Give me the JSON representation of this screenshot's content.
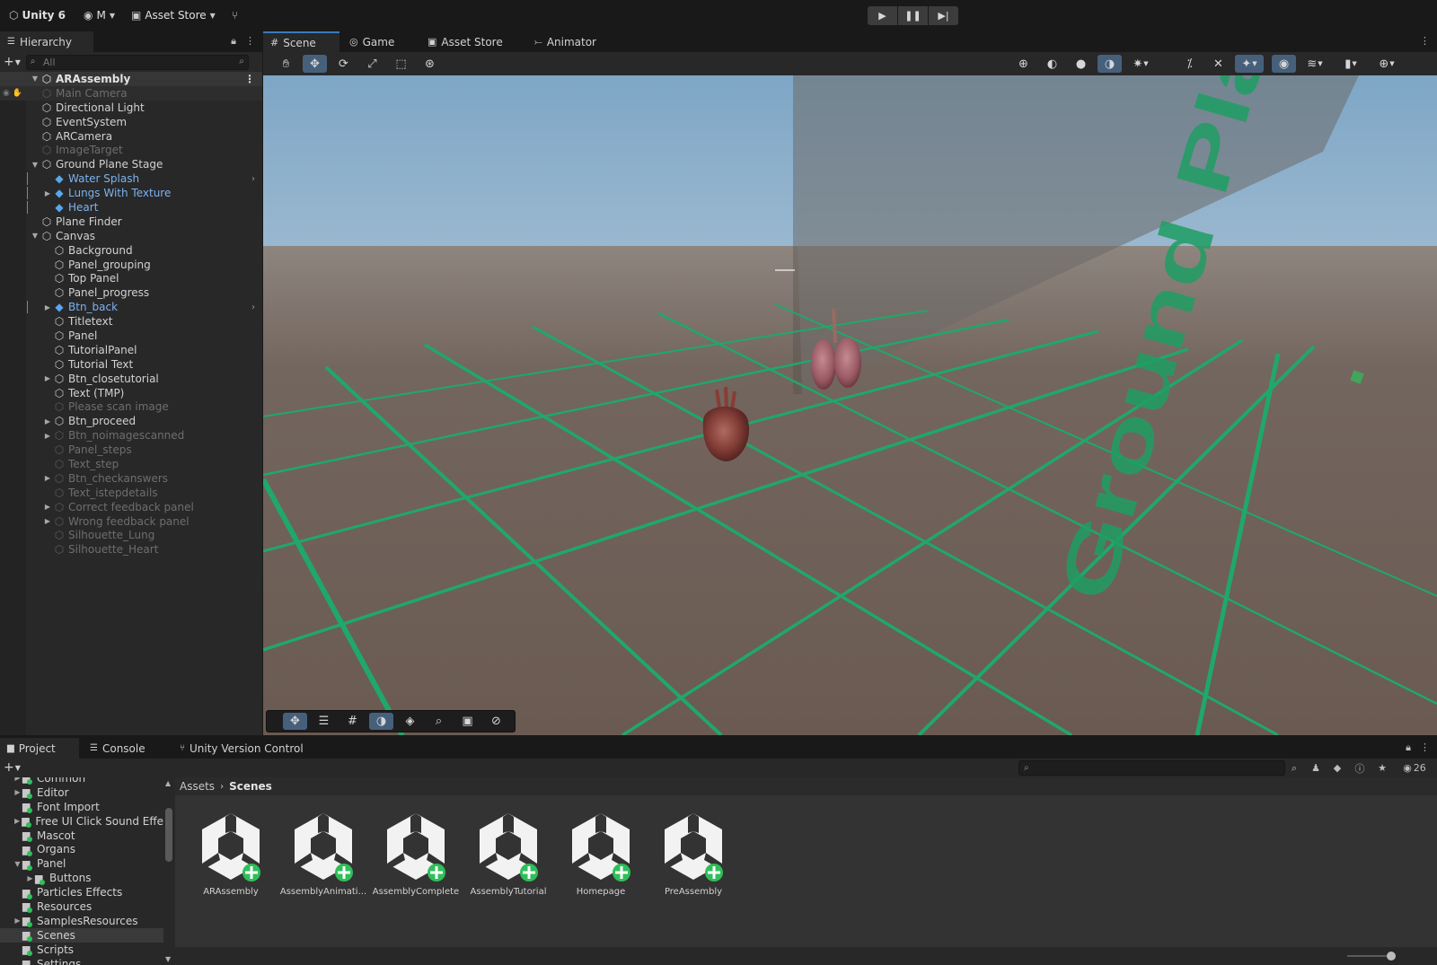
{
  "toolbar": {
    "app_title": "Unity 6",
    "account_label": "M",
    "asset_store_label": "Asset Store"
  },
  "hierarchy": {
    "tab_label": "Hierarchy",
    "search_placeholder": "All",
    "root": "ARAssembly",
    "items": [
      {
        "label": "Main Camera",
        "depth": 1,
        "state": "dim",
        "arrow": false
      },
      {
        "label": "Directional Light",
        "depth": 1,
        "state": "normal",
        "arrow": false
      },
      {
        "label": "EventSystem",
        "depth": 1,
        "state": "normal",
        "arrow": false
      },
      {
        "label": "ARCamera",
        "depth": 1,
        "state": "normal",
        "arrow": false
      },
      {
        "label": "ImageTarget",
        "depth": 1,
        "state": "dim",
        "arrow": false
      },
      {
        "label": "Ground Plane Stage",
        "depth": 1,
        "state": "normal",
        "arrow": "open"
      },
      {
        "label": "Water Splash",
        "depth": 2,
        "state": "prefab",
        "arrow": false
      },
      {
        "label": "Lungs With Texture",
        "depth": 2,
        "state": "prefab",
        "arrow": "closed"
      },
      {
        "label": "Heart",
        "depth": 2,
        "state": "prefab",
        "arrow": false
      },
      {
        "label": "Plane Finder",
        "depth": 1,
        "state": "normal",
        "arrow": false
      },
      {
        "label": "Canvas",
        "depth": 1,
        "state": "normal",
        "arrow": "open"
      },
      {
        "label": "Background",
        "depth": 2,
        "state": "normal",
        "arrow": false
      },
      {
        "label": "Panel_grouping",
        "depth": 2,
        "state": "normal",
        "arrow": false
      },
      {
        "label": "Top Panel",
        "depth": 2,
        "state": "normal",
        "arrow": false
      },
      {
        "label": "Panel_progress",
        "depth": 2,
        "state": "normal",
        "arrow": false
      },
      {
        "label": "Btn_back",
        "depth": 2,
        "state": "prefab",
        "arrow": "closed"
      },
      {
        "label": "Titletext",
        "depth": 2,
        "state": "normal",
        "arrow": false
      },
      {
        "label": "Panel",
        "depth": 2,
        "state": "normal",
        "arrow": false
      },
      {
        "label": "TutorialPanel",
        "depth": 2,
        "state": "normal",
        "arrow": false
      },
      {
        "label": "Tutorial Text",
        "depth": 2,
        "state": "normal",
        "arrow": false
      },
      {
        "label": "Btn_closetutorial",
        "depth": 2,
        "state": "normal",
        "arrow": "closed"
      },
      {
        "label": "Text (TMP)",
        "depth": 2,
        "state": "normal",
        "arrow": false
      },
      {
        "label": "Please scan image",
        "depth": 2,
        "state": "dim",
        "arrow": false
      },
      {
        "label": "Btn_proceed",
        "depth": 2,
        "state": "normal",
        "arrow": "closed"
      },
      {
        "label": "Btn_noimagescanned",
        "depth": 2,
        "state": "dim",
        "arrow": "closed"
      },
      {
        "label": "Panel_steps",
        "depth": 2,
        "state": "dim",
        "arrow": false
      },
      {
        "label": "Text_step",
        "depth": 2,
        "state": "dim",
        "arrow": false
      },
      {
        "label": "Btn_checkanswers",
        "depth": 2,
        "state": "dim",
        "arrow": "closed"
      },
      {
        "label": "Text_istepdetails",
        "depth": 2,
        "state": "dim",
        "arrow": false
      },
      {
        "label": "Correct feedback panel",
        "depth": 2,
        "state": "dim",
        "arrow": "closed"
      },
      {
        "label": "Wrong feedback panel",
        "depth": 2,
        "state": "dim",
        "arrow": "closed"
      },
      {
        "label": "Silhouette_Lung",
        "depth": 2,
        "state": "dim",
        "arrow": false
      },
      {
        "label": "Silhouette_Heart",
        "depth": 2,
        "state": "dim",
        "arrow": false
      }
    ]
  },
  "scene": {
    "tabs": [
      {
        "label": "Scene",
        "icon": "grid-icon",
        "active": true
      },
      {
        "label": "Game",
        "icon": "gamepad-icon",
        "active": false
      },
      {
        "label": "Asset Store",
        "icon": "bag-icon",
        "active": false
      },
      {
        "label": "Animator",
        "icon": "animator-icon",
        "active": false
      }
    ],
    "ground_text": "Ground Plane",
    "colors": {
      "grid_green": "#1fa86a",
      "floor": "#6e6058",
      "sky_top": "#7ea6c6",
      "horizon": "#e8ecef"
    }
  },
  "project": {
    "tabs": [
      {
        "label": "Project",
        "icon": "folder-icon",
        "active": true
      },
      {
        "label": "Console",
        "icon": "console-icon",
        "active": false
      },
      {
        "label": "Unity Version Control",
        "icon": "version-control-icon",
        "active": false
      }
    ],
    "hidden_count": "26",
    "breadcrumb": [
      "Assets",
      "Scenes"
    ],
    "folders": [
      {
        "label": "Common",
        "arrow": "closed",
        "indent": 0,
        "selected": false
      },
      {
        "label": "Editor",
        "arrow": "closed",
        "indent": 0,
        "selected": false
      },
      {
        "label": "Font Import",
        "arrow": false,
        "indent": 0,
        "selected": false
      },
      {
        "label": "Free UI Click Sound Effe",
        "arrow": "closed",
        "indent": 0,
        "selected": false
      },
      {
        "label": "Mascot",
        "arrow": false,
        "indent": 0,
        "selected": false
      },
      {
        "label": "Organs",
        "arrow": false,
        "indent": 0,
        "selected": false
      },
      {
        "label": "Panel",
        "arrow": "open",
        "indent": 0,
        "selected": false
      },
      {
        "label": "Buttons",
        "arrow": "closed",
        "indent": 1,
        "selected": false
      },
      {
        "label": "Particles Effects",
        "arrow": false,
        "indent": 0,
        "selected": false
      },
      {
        "label": "Resources",
        "arrow": false,
        "indent": 0,
        "selected": false
      },
      {
        "label": "SamplesResources",
        "arrow": "closed",
        "indent": 0,
        "selected": false
      },
      {
        "label": "Scenes",
        "arrow": false,
        "indent": 0,
        "selected": true
      },
      {
        "label": "Scripts",
        "arrow": false,
        "indent": 0,
        "selected": false
      },
      {
        "label": "Settings",
        "arrow": false,
        "indent": 0,
        "selected": false
      }
    ],
    "assets": [
      {
        "label": "ARAssembly"
      },
      {
        "label": "AssemblyAnimati..."
      },
      {
        "label": "AssemblyComplete"
      },
      {
        "label": "AssemblyTutorial"
      },
      {
        "label": "Homepage"
      },
      {
        "label": "PreAssembly"
      }
    ]
  }
}
